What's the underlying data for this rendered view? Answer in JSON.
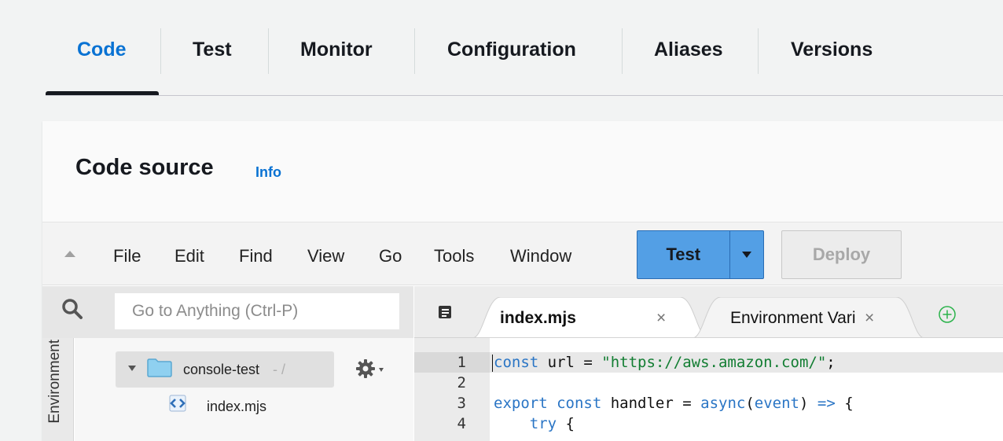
{
  "tabs": [
    {
      "label": "Code",
      "active": true
    },
    {
      "label": "Test",
      "active": false
    },
    {
      "label": "Monitor",
      "active": false
    },
    {
      "label": "Configuration",
      "active": false
    },
    {
      "label": "Aliases",
      "active": false
    },
    {
      "label": "Versions",
      "active": false
    }
  ],
  "panel": {
    "title": "Code source",
    "info_link": "Info"
  },
  "ide": {
    "menu": [
      "File",
      "Edit",
      "Find",
      "View",
      "Go",
      "Tools",
      "Window"
    ],
    "test_button": "Test",
    "deploy_button": "Deploy",
    "search": {
      "placeholder": "Go to Anything (Ctrl-P)"
    },
    "environment_label": "Environment",
    "tree": {
      "root_name": "console-test",
      "root_path": "- /",
      "files": [
        "index.mjs"
      ]
    },
    "editor_tabs": [
      {
        "label": "index.mjs",
        "close": "×",
        "active": true
      },
      {
        "label": "Environment Vari",
        "close": "×",
        "active": false
      }
    ],
    "code_lines": [
      {
        "num": "1",
        "text": "const url = \"https://aws.amazon.com/\";"
      },
      {
        "num": "2",
        "text": ""
      },
      {
        "num": "3",
        "text": "export const handler = async(event) => {"
      },
      {
        "num": "4",
        "text": "    try {"
      }
    ]
  },
  "colors": {
    "accent": "#0972d3",
    "test_button_bg": "#539fe5",
    "keyword": "#2a75c5",
    "string": "#127d32"
  }
}
